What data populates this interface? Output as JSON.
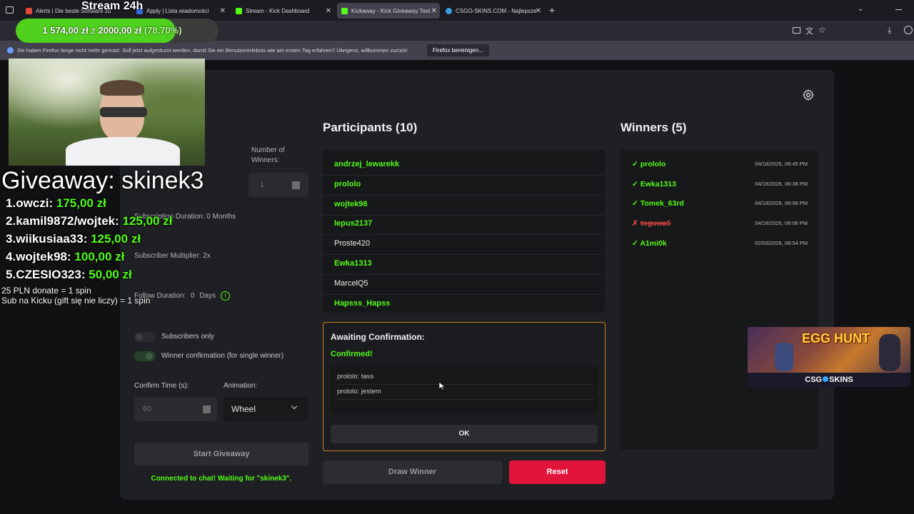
{
  "browser": {
    "tabs": [
      {
        "label": "Alerts | Die beste Software zu",
        "active": false
      },
      {
        "label": "Apply | Lista wiadomości",
        "active": false
      },
      {
        "label": "Stream - Kick Dashboard",
        "active": false
      },
      {
        "label": "Kickaway - Kick Giveaway Tool",
        "active": true
      },
      {
        "label": "CSGO-SKINS.COM - Najlepsze",
        "active": false
      }
    ],
    "new_tab": "+",
    "notification": {
      "text": "Sie haben Firefox lange nicht mehr genutzt. Soll jetzt aufgeräumt werden, damit Sie ein Benutzererlebnis wie am ersten Tag erfahren? Übrigens, willkommen zurück!",
      "button": "Firefox bereinigen..."
    }
  },
  "overlay": {
    "stream_title": "Stream 24h",
    "donation": {
      "current": "1 574,00 zł",
      "connector": "z",
      "goal": "2000,00 zł",
      "percent": "(78.70%)",
      "fraction": 0.787
    },
    "giveaway_title": "Giveaway: skinek3",
    "leaderboard": [
      {
        "rank": "1.",
        "name": "owczi:",
        "amount": "175,00 zł"
      },
      {
        "rank": "2.",
        "name": "kamil9872/wojtek:",
        "amount": "125,00 zł"
      },
      {
        "rank": "3.",
        "name": "wiikusiaa33:",
        "amount": "125,00 zł"
      },
      {
        "rank": "4.",
        "name": "wojtek98:",
        "amount": "100,00 zł"
      },
      {
        "rank": "5.",
        "name": "CZESIO323:",
        "amount": "50,00 zł"
      }
    ],
    "rules": [
      "25 PLN donate = 1 spin",
      "Sub na Kicku (gift się nie liczy) = 1 spin"
    ],
    "sponsor": {
      "title": "EGG HUNT",
      "brand": "CSG",
      "brand2": "SKINS"
    }
  },
  "settings": {
    "number_of_winners_label": "Number of Winners:",
    "number_of_winners_value": "1",
    "subscription_duration": "Subscription Duration: 0 Months",
    "subscriber_multiplier": "Subscriber Multiplier: 2x",
    "follow_duration_label": "Follow Duration:",
    "follow_duration_value": "0",
    "follow_duration_unit": "Days",
    "info_glyph": "!",
    "subscribers_only": "Subscribers only",
    "winner_confirmation": "Winner confirmation (for single winner)",
    "confirm_time_label": "Confirm Time (s):",
    "confirm_time_value": "60",
    "animation_label": "Animation:",
    "animation_value": "Wheel",
    "start_button": "Start Giveaway",
    "status": "Connected to chat! Waiting for \"skinek3\"."
  },
  "participants": {
    "title": "Participants (10)",
    "items": [
      {
        "name": "andrzej_lewarekk",
        "highlight": true
      },
      {
        "name": "prololo",
        "highlight": true
      },
      {
        "name": "wojtek98",
        "highlight": true
      },
      {
        "name": "lepus2137",
        "highlight": true
      },
      {
        "name": "Proste420",
        "highlight": false
      },
      {
        "name": "Ewka1313",
        "highlight": true
      },
      {
        "name": "MarcelQ5",
        "highlight": false
      },
      {
        "name": "Hapsss_Hapss",
        "highlight": true
      }
    ]
  },
  "confirmation": {
    "title": "Awaiting Confirmation:",
    "status": "Confirmed!",
    "messages": [
      "prololo: tass",
      "prololo: jestem"
    ],
    "ok_button": "OK"
  },
  "actions": {
    "draw_button": "Draw Winner",
    "reset_button": "Reset"
  },
  "winners": {
    "title": "Winners (5)",
    "items": [
      {
        "mark": "✓",
        "name": "prololo",
        "date": "04/18/2026, 06:45 PM",
        "status": "confirmed"
      },
      {
        "mark": "✓",
        "name": "Ewka1313",
        "date": "04/18/2026, 06:38 PM",
        "status": "confirmed"
      },
      {
        "mark": "✓",
        "name": "Tomek_63rd",
        "date": "04/18/2026, 06:08 PM",
        "status": "confirmed"
      },
      {
        "mark": "✗",
        "name": "toguwa5",
        "date": "04/18/2026, 06:06 PM",
        "status": "rejected"
      },
      {
        "mark": "✓",
        "name": "A1mi0k",
        "date": "02/03/2026, 08:54 PM",
        "status": "confirmed"
      }
    ]
  },
  "colors": {
    "kick_green": "#53fc18",
    "reset_red": "#e2143c",
    "reject_red": "#e0453f",
    "confirm_border": "#c8811d"
  },
  "icons": {
    "settings": "gear-icon",
    "dropdown": "chevron-down-icon",
    "info": "info-icon"
  }
}
